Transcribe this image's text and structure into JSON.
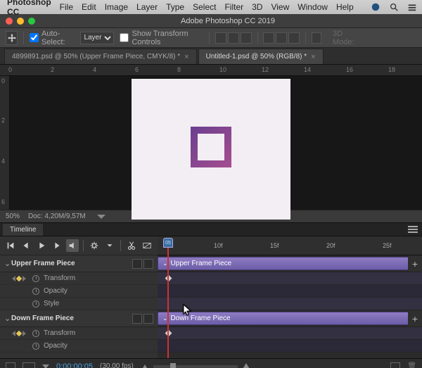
{
  "menu": {
    "app": "Photoshop CC",
    "items": [
      "File",
      "Edit",
      "Image",
      "Layer",
      "Type",
      "Select",
      "Filter",
      "3D",
      "View",
      "Window",
      "Help"
    ]
  },
  "window_title": "Adobe Photoshop CC 2019",
  "options": {
    "auto_select": "Auto-Select:",
    "layer_mode": "Layer",
    "show_transform": "Show Transform Controls",
    "mode3d": "3D Mode:"
  },
  "tabs": [
    {
      "label": "4899891.psd @ 50% (Upper Frame Piece, CMYK/8) *"
    },
    {
      "label": "Untitled-1.psd @ 50% (RGB/8) *"
    }
  ],
  "ruler": {
    "h": [
      "0",
      "2",
      "4",
      "6",
      "8",
      "10",
      "12",
      "14",
      "16",
      "18"
    ],
    "v": [
      "0",
      "2",
      "4",
      "6"
    ]
  },
  "status": {
    "zoom": "50%",
    "doc": "Doc: 4,20M/9,57M"
  },
  "timeline": {
    "panel": "Timeline",
    "frames": [
      "10f",
      "15f",
      "20f",
      "25f"
    ],
    "playhead": "05",
    "layers": [
      {
        "name": "Upper Frame Piece",
        "props": [
          "Transform",
          "Opacity",
          "Style"
        ]
      },
      {
        "name": "Down Frame Piece",
        "props": [
          "Transform",
          "Opacity"
        ]
      }
    ],
    "bottom": {
      "time": "0:00:00:05",
      "fps": "(30,00 fps)"
    }
  }
}
